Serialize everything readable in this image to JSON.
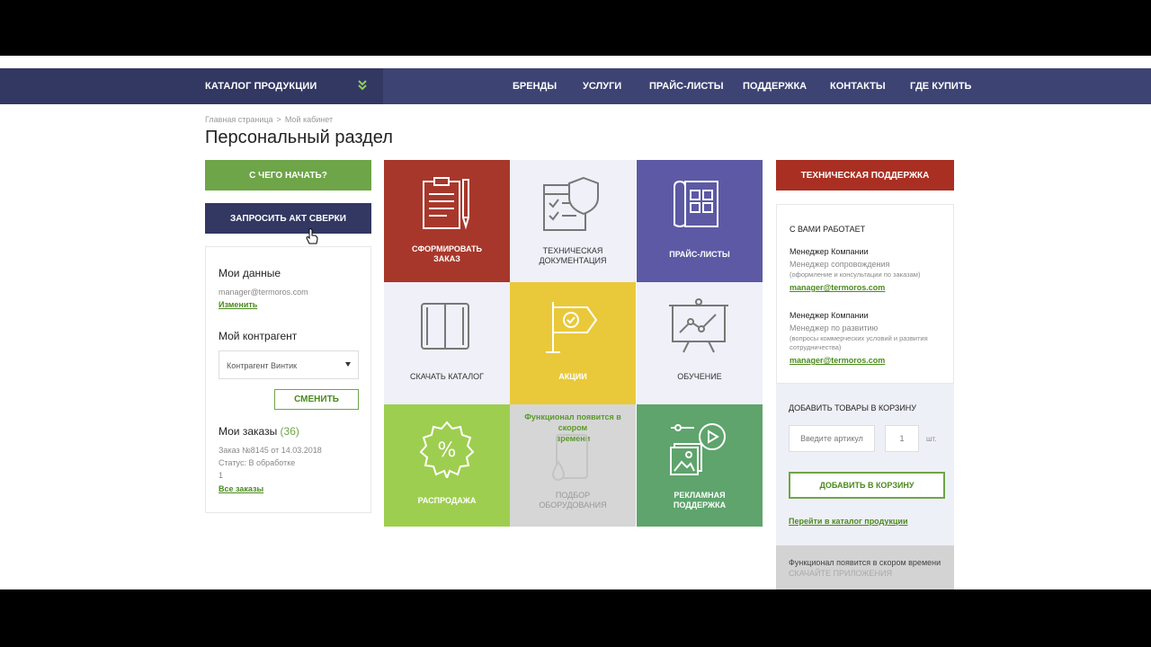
{
  "nav": {
    "catalog_label": "КАТАЛОГ ПРОДУКЦИИ",
    "items": [
      "БРЕНДЫ",
      "УСЛУГИ",
      "ПРАЙС-ЛИСТЫ",
      "ПОДДЕРЖКА",
      "КОНТАКТЫ",
      "ГДЕ КУПИТЬ"
    ]
  },
  "breadcrumb": {
    "home": "Главная страница",
    "sep": ">",
    "current": "Мой кабинет"
  },
  "page_title": "Персональный раздел",
  "left": {
    "start_button": "С ЧЕГО НАЧАТЬ?",
    "act_button": "ЗАПРОСИТЬ АКТ СВЕРКИ",
    "my_data_title": "Мои данные",
    "email": "manager@termoros.com",
    "change_link": "Изменить",
    "counterparty_title": "Мой контрагент",
    "counterparty_value": "Контрагент Винтик",
    "change_button": "СМЕНИТЬ",
    "orders_title": "Мои заказы",
    "orders_count": "(36)",
    "order_line": "Заказ №8145 от 14.03.2018",
    "order_status": "Статус: В обработке",
    "order_qty": "1",
    "all_orders_link": "Все заказы"
  },
  "tiles": [
    {
      "label1": "СФОРМИРОВАТЬ",
      "label2": "ЗАКАЗ",
      "color": "#a8372b",
      "icon": "clipboard-icon"
    },
    {
      "label1": "ТЕХНИЧЕСКАЯ",
      "label2": "ДОКУМЕНТАЦИЯ",
      "color": "#eff0f8",
      "icon": "document-shield-icon"
    },
    {
      "label1": "ПРАЙС-ЛИСТЫ",
      "label2": "",
      "color": "#5d59a4",
      "icon": "price-list-icon"
    },
    {
      "label1": "СКАЧАТЬ КАТАЛОГ",
      "label2": "",
      "color": "#eff0f8",
      "icon": "book-icon"
    },
    {
      "label1": "АКЦИИ",
      "label2": "",
      "color": "#e9c93a",
      "icon": "flag-icon"
    },
    {
      "label1": "ОБУЧЕНИЕ",
      "label2": "",
      "color": "#eff0f8",
      "icon": "presentation-icon"
    },
    {
      "label1": "РАСПРОДАЖА",
      "label2": "",
      "color": "#9ece4f",
      "icon": "percent-badge-icon"
    },
    {
      "label1": "ПОДБОР",
      "label2": "ОБОРУДОВАНИЯ",
      "color": "#d6d6d6",
      "icon": "tablet-drop-icon",
      "soon1": "Функционал появится в скором",
      "soon2": "времени"
    },
    {
      "label1": "РЕКЛАМНАЯ",
      "label2": "ПОДДЕРЖКА",
      "color": "#5ea46c",
      "icon": "media-icon"
    }
  ],
  "right": {
    "support_button": "ТЕХНИЧЕСКАЯ ПОДДЕРЖКА",
    "working_with": "С ВАМИ РАБОТАЕТ",
    "manager1_title": "Менеджер Компании",
    "manager1_role": "Менеджер сопровождения",
    "manager1_note": "(оформление и консультации по заказам)",
    "manager1_email": "manager@termoros.com",
    "manager2_title": "Менеджер Компании",
    "manager2_role": "Менеджер по развитию",
    "manager2_note": "(вопросы коммерческих условий и развития сотрудничества)",
    "manager2_email": "manager@termoros.com",
    "cart_title": "ДОБАВИТЬ ТОВАРЫ В КОРЗИНУ",
    "article_placeholder": "Введите артикул",
    "qty_value": "1",
    "unit": "шт.",
    "add_to_cart": "ДОБАВИТЬ В КОРЗИНУ",
    "catalog_link": "Перейти в каталог продукции",
    "soon": "Функционал появится в скором времени",
    "download_apps": "СКАЧАЙТЕ ПРИЛОЖЕНИЯ"
  }
}
